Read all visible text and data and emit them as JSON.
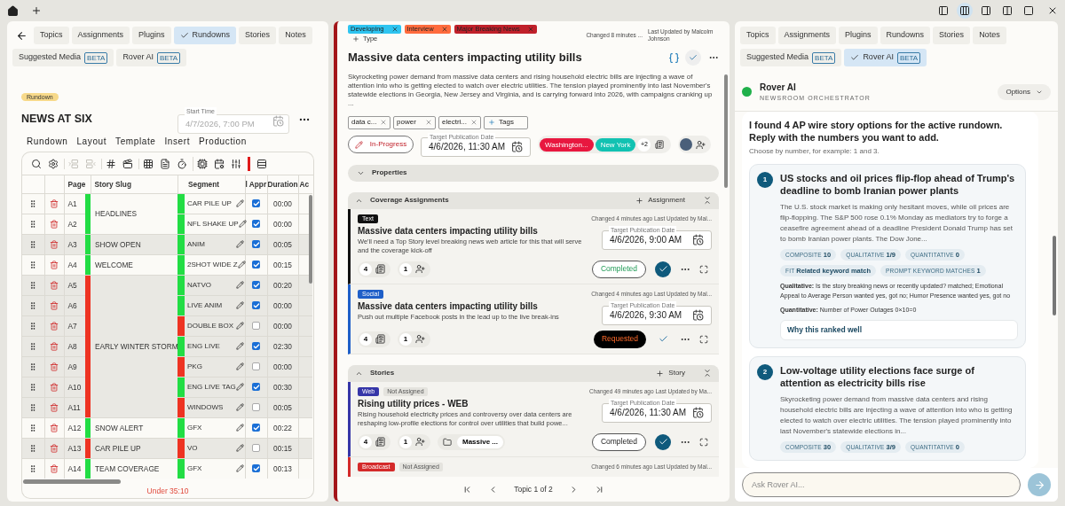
{
  "top_bar": {
    "layout_buttons": [
      {
        "selected": false
      },
      {
        "selected": true
      },
      {
        "selected": false
      },
      {
        "selected": false
      },
      {
        "selected": false
      }
    ]
  },
  "left_panel": {
    "tab_rows": [
      [
        {
          "label": "Topics",
          "selected": false
        },
        {
          "label": "Assignments",
          "selected": false
        },
        {
          "label": "Plugins",
          "selected": false
        },
        {
          "label": "Rundowns",
          "selected": true
        },
        {
          "label": "Stories",
          "selected": false
        },
        {
          "label": "Notes",
          "selected": false
        }
      ],
      [
        {
          "label": "Suggested Media",
          "badge": "BETA",
          "selected": false
        },
        {
          "label": "Rover AI",
          "badge": "BETA",
          "selected": false
        }
      ]
    ],
    "badge": "Rundown",
    "title": "NEWS AT SIX",
    "start_time": {
      "label": "Start Time",
      "placeholder": "4/7/2026, 7:00 PM"
    },
    "menu": [
      "Rundown",
      "Layout",
      "Template",
      "Insert",
      "Production"
    ],
    "toolbar_groups": [
      [
        {
          "kind": "search",
          "disabled": false
        },
        {
          "kind": "settings",
          "disabled": false
        }
      ],
      [
        {
          "kind": "insert-above",
          "disabled": true
        },
        {
          "kind": "insert-below",
          "disabled": true
        }
      ],
      [
        {
          "kind": "number",
          "disabled": false
        },
        {
          "kind": "clapper",
          "disabled": false
        }
      ],
      [
        {
          "kind": "grid",
          "disabled": false
        },
        {
          "kind": "script",
          "disabled": false
        },
        {
          "kind": "timer",
          "disabled": false
        }
      ],
      [
        {
          "kind": "chip",
          "disabled": false
        },
        {
          "kind": "schedule",
          "disabled": false
        },
        {
          "kind": "mixer",
          "disabled": false
        },
        {
          "kind": "marker",
          "disabled": false
        },
        {
          "kind": "list",
          "disabled": false
        }
      ]
    ],
    "columns": [
      "Page",
      "Story Slug",
      "Segment",
      "l Appr",
      "Duration",
      "Ac"
    ],
    "stories": [
      {
        "slug": "HEADLINES",
        "color": "#22dd44",
        "rows": [
          {
            "page": "A1",
            "segment": "CAR PILE UP",
            "color": "#22dd44",
            "approved": true,
            "duration": "00:00"
          },
          {
            "page": "A2",
            "segment": "NFL SHAKE UP",
            "color": "#22dd44",
            "approved": true,
            "duration": "00:00"
          }
        ]
      },
      {
        "slug": "SHOW OPEN",
        "color": "#22dd44",
        "rows": [
          {
            "page": "A3",
            "segment": "ANIM",
            "color": "#22dd44",
            "approved": true,
            "duration": "00:05"
          }
        ]
      },
      {
        "slug": "WELCOME",
        "color": "#22dd44",
        "rows": [
          {
            "page": "A4",
            "segment": "2SHOT WIDE Z",
            "color": "#22dd44",
            "approved": true,
            "duration": "00:15"
          }
        ]
      },
      {
        "slug": "EARLY WINTER STORM",
        "color": "#ee3322",
        "rows": [
          {
            "page": "A5",
            "segment": "NATVO",
            "color": "#22dd44",
            "approved": true,
            "duration": "00:20"
          },
          {
            "page": "A6",
            "segment": "LIVE ANIM",
            "color": "#22dd44",
            "approved": true,
            "duration": "00:00"
          },
          {
            "page": "A7",
            "segment": "DOUBLE BOX",
            "color": "#ee3322",
            "approved": false,
            "duration": "00:00"
          },
          {
            "page": "A8",
            "segment": "ENG LIVE",
            "color": "#22dd44",
            "approved": true,
            "duration": "02:30"
          },
          {
            "page": "A9",
            "segment": "PKG",
            "color": "#ee3322",
            "approved": false,
            "duration": "00:00"
          },
          {
            "page": "A10",
            "segment": "ENG LIVE TAG",
            "color": "#22dd44",
            "approved": true,
            "duration": "00:30"
          },
          {
            "page": "A11",
            "segment": "WINDOWS",
            "color": "#ee3322",
            "approved": false,
            "duration": "00:05"
          }
        ]
      },
      {
        "slug": "SNOW ALERT",
        "color": "#22dd44",
        "rows": [
          {
            "page": "A12",
            "segment": "GFX",
            "color": "#22dd44",
            "approved": true,
            "duration": "00:22"
          }
        ]
      },
      {
        "slug": "CAR PILE UP",
        "color": "#ee3322",
        "rows": [
          {
            "page": "A13",
            "segment": "VO",
            "color": "#ee3322",
            "approved": false,
            "duration": "00:15"
          }
        ]
      },
      {
        "slug": "TEAM COVERAGE",
        "color": "#22dd44",
        "rows": [
          {
            "page": "A14",
            "segment": "GFX",
            "color": "#22dd44",
            "approved": true,
            "duration": "00:13"
          }
        ]
      }
    ],
    "footer": "Under 35:10"
  },
  "story": {
    "type_tags": [
      {
        "label": "Developing",
        "color": "#2ec4f0"
      },
      {
        "label": "Interview",
        "color": "#ff6b3d"
      },
      {
        "label": "Major Breaking News",
        "color": "#c0202a"
      }
    ],
    "add_type": "Type",
    "changed": "Changed 8 minutes ...",
    "last_updated": "Last Updated by Malcolm Johnson",
    "title": "Massive data centers impacting utility bills",
    "summary": "Skyrocketing power demand from massive data centers and rising household electric bills are injecting a wave of attention into who is getting elected to watch over electric utilities. The tension played prominently into last November's statewide elections in Georgia, New Jersey and Virginia, and is carrying forward into 2026, with campaigns cranking up ...",
    "tags": [
      "data c...",
      "power",
      "electri..."
    ],
    "add_tag": "Tags",
    "status": "In-Progress",
    "target_date": {
      "label": "Target Publication Date",
      "value": "4/6/2026, 11:30 AM"
    },
    "locations": [
      {
        "label": "Washington...",
        "color": "#e8173f"
      },
      {
        "label": "New York",
        "color": "#12c2b2"
      }
    ],
    "more_locations": "+2",
    "properties": {
      "title": "Properties",
      "expanded": false
    },
    "sections": [
      {
        "title": "Coverage Assignments",
        "add": "Assignment",
        "expanded": true,
        "items": [
          {
            "kind_label": "Text",
            "color": "#111111",
            "changed": "Changed 4 minutes ago Last Updated by Mal...",
            "title": "Massive data centers impacting utility bills",
            "description": "We'll need a Top Story level breaking news web article for this that will serve and the coverage kick-off",
            "date_label": "Target Publication Date",
            "date": "4/6/2026, 9:00 AM",
            "counts": [
              "4",
              "1"
            ],
            "status": {
              "label": "Completed",
              "kind": "success"
            },
            "done": true
          },
          {
            "kind_label": "Social",
            "color": "#1f5fc8",
            "changed": "Changed 4 minutes ago Last Updated by Mal...",
            "title": "Massive data centers impacting utility bills",
            "description": "Push out multiple Facebook posts in the lead up to the live break-ins",
            "date_label": "Target Publication Date",
            "date": "4/6/2026, 9:30 AM",
            "counts": [
              "4",
              "1"
            ],
            "status": {
              "label": "Requested",
              "kind": "alert"
            },
            "done": false
          }
        ]
      },
      {
        "title": "Stories",
        "add": "Story",
        "expanded": true,
        "items": [
          {
            "kind_label": "Web",
            "color": "#3636a8",
            "assigned": "Not Assigned",
            "changed": "Changed 49 minutes ago Last Updated by Ma...",
            "title": "Rising utility prices - WEB",
            "description": "Rising household electricity prices and controversy over data centers are reshaping low-profile elections for control over utilities that build powe...",
            "date_label": "Target Publication Date",
            "date": "4/6/2026, 11:30 AM",
            "counts": [
              "4",
              "1"
            ],
            "folder": "Massive ...",
            "status": {
              "label": "Completed",
              "kind": "plain"
            },
            "done": true
          },
          {
            "kind_label": "Broadcast",
            "color": "#d42a2a",
            "assigned": "Not Assigned",
            "changed": "Changed 6 minutes ago Last Updated by Mal..."
          }
        ]
      }
    ],
    "pager": "Topic 1 of 2"
  },
  "right_panel": {
    "tab_rows": [
      [
        {
          "label": "Topics",
          "selected": false
        },
        {
          "label": "Assignments",
          "selected": false
        },
        {
          "label": "Plugins",
          "selected": false
        },
        {
          "label": "Rundowns",
          "selected": false
        },
        {
          "label": "Stories",
          "selected": false
        },
        {
          "label": "Notes",
          "selected": false
        }
      ],
      [
        {
          "label": "Suggested Media",
          "badge": "BETA",
          "selected": false
        },
        {
          "label": "Rover AI",
          "badge": "BETA",
          "selected": true
        }
      ]
    ],
    "assistant": {
      "name": "Rover AI",
      "subtitle": "NEWSROOM ORCHESTRATOR",
      "options": "Options"
    },
    "message": {
      "heading": "I found 4 AP wire story options for the active rundown. Reply with the numbers you want to add.",
      "hint": "Choose by number, for example: 1 and 3.",
      "options": [
        {
          "number": "1",
          "title": "US stocks and oil prices flip-flop ahead of Trump's deadline to bomb Iranian power plants",
          "summary": "The U.S. stock market is making only hesitant moves, while oil prices are flip-flopping. The S&P 500 rose 0.1% Monday as mediators try to forge a ceasefire agreement ahead of a deadline President Donald Trump has set to bomb Iranian power plants. The Dow Jone...",
          "metric_rows": [
            [
              {
                "label": "COMPOSITE",
                "value": "10"
              },
              {
                "label": "QUALITATIVE",
                "value": "1/9"
              },
              {
                "label": "QUANTITATIVE",
                "value": "0"
              }
            ],
            [
              {
                "label": "FIT",
                "value": "Related keyword match"
              },
              {
                "label": "PROMPT KEYWORD MATCHES",
                "value": "1"
              }
            ]
          ],
          "notes": [
            "**Qualitative:** Is the story breaking news or recently updated? matched; Emotional Appeal to Average Person wanted yes, got no; Humor Presence wanted yes, got no",
            "**Quantitative:** Number of Power Outages 0×10=0"
          ],
          "why": "Why this ranked well"
        },
        {
          "number": "2",
          "title": "Low-voltage utility elections face surge of attention as electricity bills rise",
          "summary": "Skyrocketing power demand from massive data centers and rising household electric bills are injecting a wave of attention into who is getting elected to watch over electric utilities. The tension played prominently into last November's statewide elections in...",
          "metric_rows": [
            [
              {
                "label": "COMPOSITE",
                "value": "30"
              },
              {
                "label": "QUALITATIVE",
                "value": "3/9"
              },
              {
                "label": "QUANTITATIVE",
                "value": "0"
              }
            ]
          ]
        }
      ]
    },
    "input": {
      "placeholder": "Ask Rover AI..."
    }
  }
}
